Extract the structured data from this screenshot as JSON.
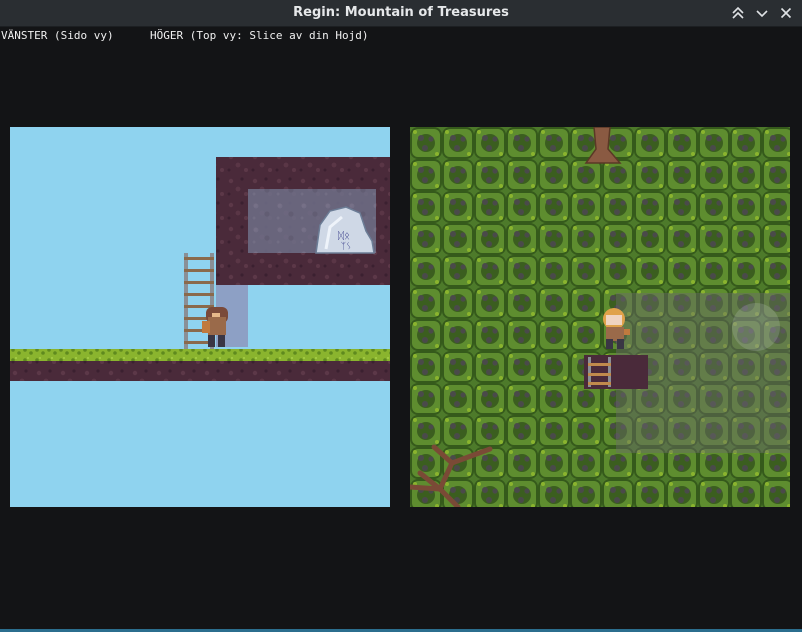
{
  "window": {
    "title": "Regin: Mountain of Treasures",
    "controls": [
      "keep-above",
      "minimize",
      "close"
    ]
  },
  "views": {
    "left_label": "VÄNSTER (Sido vy)",
    "right_label": "HÖGER (Top vy: Slice av din Hojd)"
  },
  "colors": {
    "sky": "#8fd3ef",
    "dirt": "#4a2a3a",
    "grass": "#8ab42e",
    "forest": "#4d7a2a",
    "window_bg": "#131416",
    "titlebar": "#2a2e32",
    "accent_edge": "#2b6e8e"
  }
}
